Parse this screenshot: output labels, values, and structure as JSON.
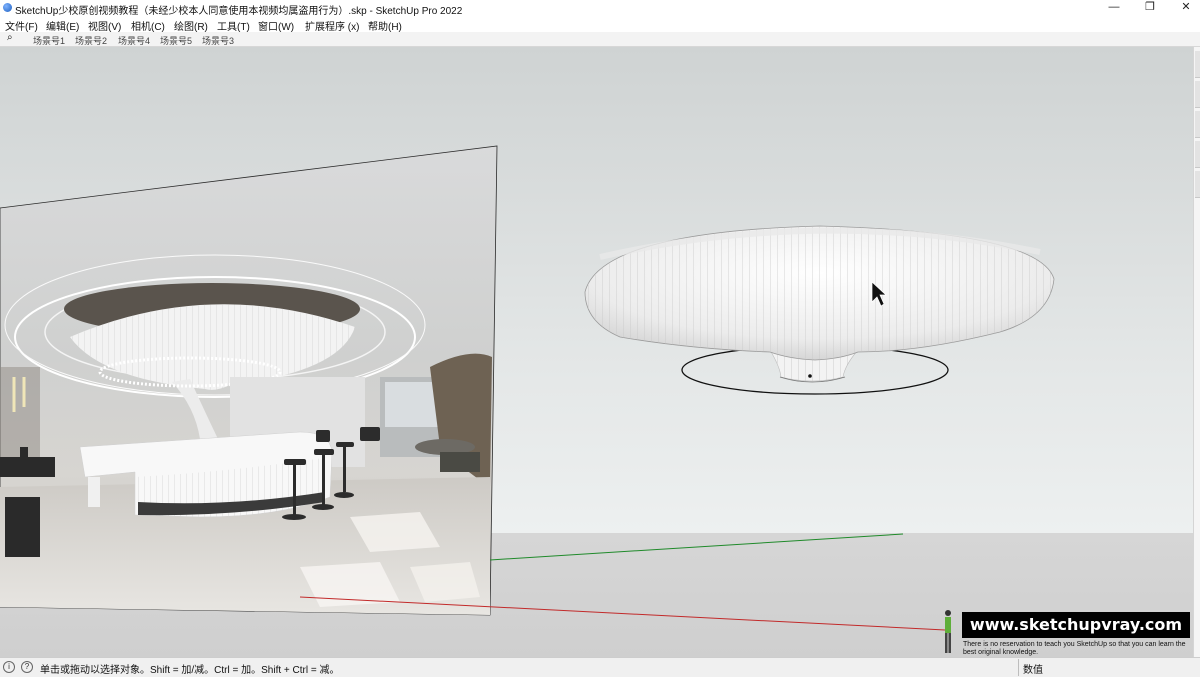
{
  "window": {
    "title": "SketchUp少校原创视频教程（未经少校本人同意使用本视频均属盗用行为）.skp - SketchUp Pro 2022",
    "minimize": "—",
    "maximize": "❐",
    "close": "✕"
  },
  "menu": [
    "文件(F)",
    "编辑(E)",
    "视图(V)",
    "相机(C)",
    "绘图(R)",
    "工具(T)",
    "窗口(W)",
    "扩展程序 (x)",
    "帮助(H)"
  ],
  "scenes": {
    "search_icon": "⌕",
    "tabs": [
      "场景号1",
      "场景号2",
      "场景号4",
      "场景号5",
      "场景号3"
    ]
  },
  "status": {
    "text": "单击或拖动以选择对象。Shift = 加/减。Ctrl = 加。Shift + Ctrl = 减。",
    "measurements_label": "数值"
  },
  "watermark": {
    "url": "www.sketchupvray.com",
    "tagline": "There is no reservation to teach you SketchUp so that you can learn the best original knowledge."
  },
  "colors": {
    "red_axis": "#c22a2a",
    "green_axis": "#1f8a2a",
    "accent": "#1d5fc0"
  },
  "icons": [
    "app-icon",
    "search-icon",
    "info-icon",
    "help-icon",
    "cursor-icon"
  ]
}
